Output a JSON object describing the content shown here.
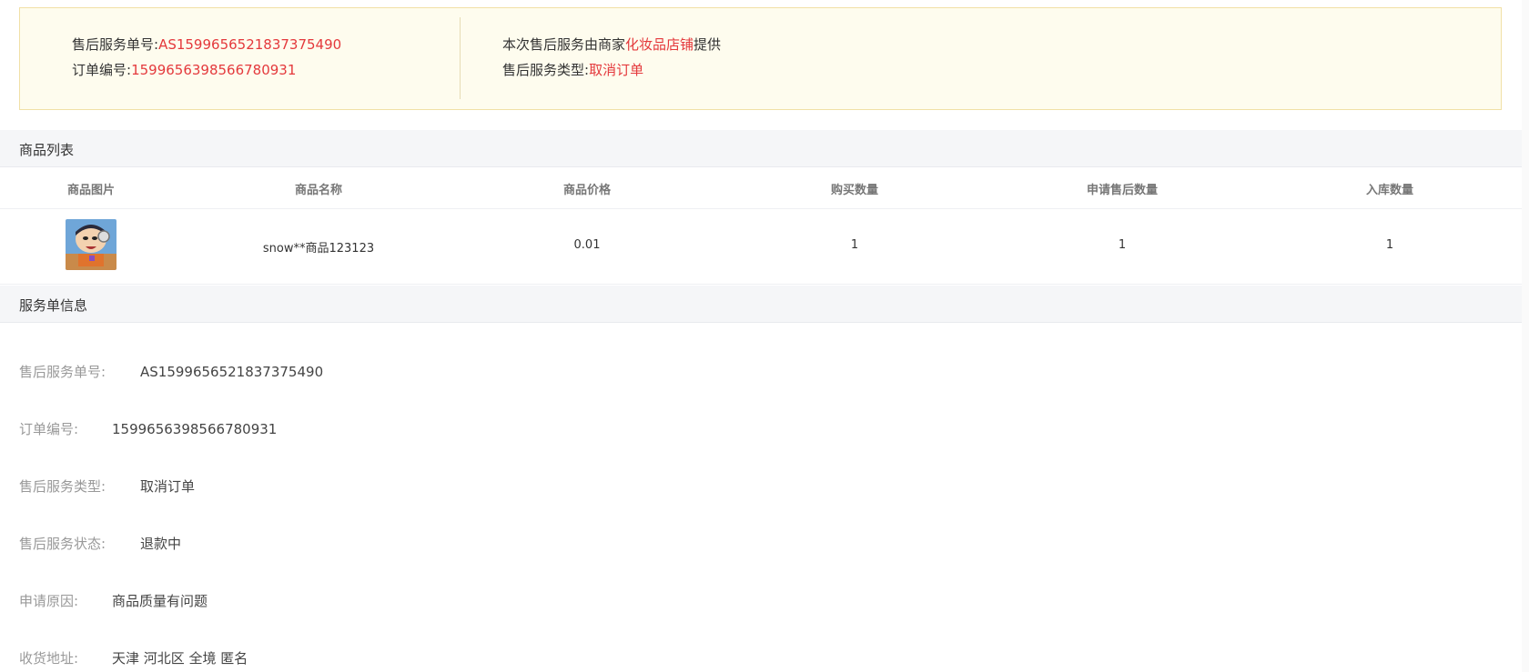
{
  "summary": {
    "service_no_label": "售后服务单号:",
    "service_no": "AS1599656521837375490",
    "order_no_label": "订单编号:",
    "order_no": "1599656398566780931",
    "provider_prefix": "本次售后服务由商家",
    "shop_name": "化妆品店铺",
    "provider_suffix": "提供",
    "service_type_label": "售后服务类型:",
    "service_type": "取消订单"
  },
  "goods_section": {
    "title": "商品列表",
    "columns": [
      "商品图片",
      "商品名称",
      "商品价格",
      "购买数量",
      "申请售后数量",
      "入库数量"
    ],
    "row": {
      "image_icon": "product-thumbnail-cartoon",
      "name": "snow**商品123123",
      "price": "0.01",
      "buy_qty": "1",
      "apply_qty": "1",
      "stock_qty": "1"
    }
  },
  "service_section": {
    "title": "服务单信息",
    "rows": [
      {
        "label": "售后服务单号:",
        "value": "AS1599656521837375490"
      },
      {
        "label": "订单编号:",
        "value": "1599656398566780931"
      },
      {
        "label": "售后服务类型:",
        "value": "取消订单"
      },
      {
        "label": "售后服务状态:",
        "value": "退款中"
      },
      {
        "label": "申请原因:",
        "value": "商品质量有问题"
      },
      {
        "label": "收货地址:",
        "value": "天津 河北区 全境 匿名"
      }
    ]
  },
  "colors": {
    "accent_red": "#e4393c",
    "link_blue": "#3d7ec9",
    "summary_bg": "#fefcee"
  }
}
